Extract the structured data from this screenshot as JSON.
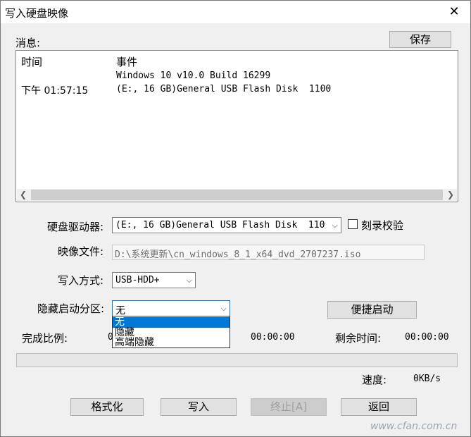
{
  "window": {
    "title": "写入硬盘映像",
    "close_glyph": "✕"
  },
  "messages": {
    "label": "消息:",
    "save_button": "保存",
    "columns": [
      "时间",
      "事件"
    ],
    "rows": [
      {
        "time": "",
        "event": "Windows 10 v10.0 Build 16299"
      },
      {
        "time": "下午 01:57:15",
        "event": "(E:, 16 GB)General USB Flash Disk  1100"
      }
    ]
  },
  "drive": {
    "label": "硬盘驱动器:",
    "value": "(E:, 16 GB)General USB Flash Disk  110",
    "verify_label": "刻录校验",
    "verify_checked": false
  },
  "image_file": {
    "label": "映像文件:",
    "value": "D:\\系统更新\\cn_windows_8_1_x64_dvd_2707237.iso"
  },
  "write_method": {
    "label": "写入方式:",
    "value": "USB-HDD+"
  },
  "hidden_partition": {
    "label": "隐藏启动分区:",
    "value": "无",
    "options": [
      "无",
      "隐藏",
      "高端隐藏"
    ],
    "selected_index": 0
  },
  "quick_boot_button": "便捷启动",
  "progress": {
    "ratio_label": "完成比例:",
    "ratio_value_partial": "0",
    "elapsed_value": "00:00:00",
    "remaining_label": "剩余时间:",
    "remaining_value": "00:00:00",
    "fraction": 0,
    "speed_label": "速度:",
    "speed_value": "0KB/s"
  },
  "buttons": {
    "format": "格式化",
    "write": "写入",
    "stop": "终止[A]",
    "back": "返回"
  },
  "watermark": "www.cfan.com.cn",
  "colors": {
    "selection": "#0078d7",
    "window_bg": "#f0f0f0"
  }
}
